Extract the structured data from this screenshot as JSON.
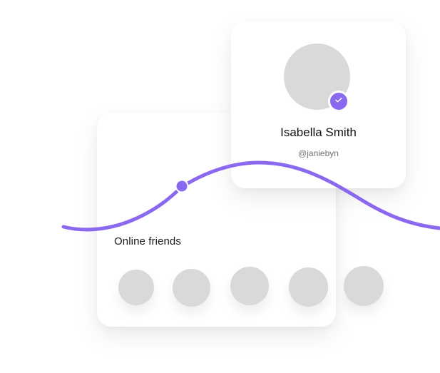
{
  "profile": {
    "name": "Isabella Smith",
    "handle": "@janiebyn",
    "verified": true,
    "avatar_icon": "user-avatar-placeholder",
    "badge_icon": "check-icon"
  },
  "friends": {
    "title": "Online friends",
    "avatars": [
      {
        "name": "friend-1"
      },
      {
        "name": "friend-2"
      },
      {
        "name": "friend-3"
      },
      {
        "name": "friend-4"
      },
      {
        "name": "friend-5"
      }
    ]
  },
  "colors": {
    "accent": "#8b68f0",
    "placeholder": "#d9d9d9",
    "card": "#ffffff",
    "text": "#111114",
    "muted": "#6f6f7a"
  }
}
